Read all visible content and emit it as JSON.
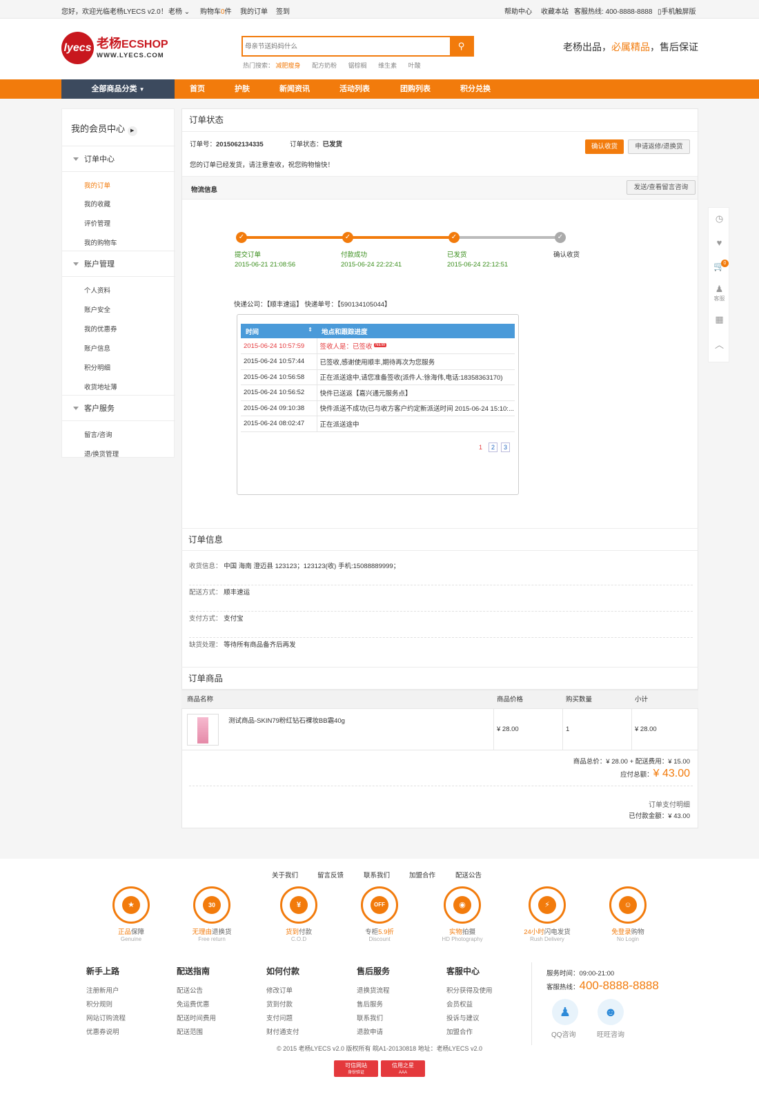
{
  "topbar": {
    "welcome": "您好，欢迎光临老杨LYECS v2.0！",
    "user": "老杨",
    "cart_pre": "购物车",
    "cart_count": "0",
    "cart_suf": "件",
    "orders": "我的订单",
    "signin": "签到",
    "help": "帮助中心",
    "fav": "收藏本站",
    "hotline": "客服热线: 400-8888-8888",
    "mobile": "手机触屏版"
  },
  "header": {
    "logo_badge": "lyecs",
    "logo_cn": "老杨",
    "logo_en": "ECSHOP",
    "logo_url": "WWW.LYECS.COM",
    "search_placeholder": "母亲节送妈妈什么",
    "hot_label": "热门搜索：",
    "hot": [
      "减肥瘦身",
      "配方奶粉",
      "锯棕榈",
      "维生素",
      "叶酸"
    ],
    "slogan_a": "老杨出品，",
    "slogan_b": "必属精品",
    "slogan_c": "，售后保证"
  },
  "nav": {
    "allcat": "全部商品分类",
    "items": [
      "首页",
      "护肤",
      "新闻资讯",
      "活动列表",
      "团购列表",
      "积分兑换"
    ]
  },
  "sidebar": {
    "title": "我的会员中心",
    "sections": [
      {
        "label": "订单中心",
        "items": [
          "我的订单",
          "我的收藏",
          "评价管理",
          "我的购物车"
        ]
      },
      {
        "label": "账户管理",
        "items": [
          "个人资料",
          "账户安全",
          "我的优惠券",
          "账户信息",
          "积分明细",
          "收货地址薄"
        ]
      },
      {
        "label": "客户服务",
        "items": [
          "留言/咨询",
          "退/换货管理"
        ]
      }
    ]
  },
  "order": {
    "status_title": "订单状态",
    "no_label": "订单号：",
    "no": "2015062134335",
    "state_label": "订单状态：",
    "state": "已发货",
    "notice": "您的订单已经发货，请注意查收，祝您购物愉快！",
    "confirm_btn": "确认收货",
    "repair_btn": "申请返修/退换货",
    "logistics": "物流信息",
    "msg_btn": "发送/查看留言咨询"
  },
  "steps": [
    {
      "label": "提交订单",
      "time": "2015-06-21 21:08:56",
      "done": true
    },
    {
      "label": "付款成功",
      "time": "2015-06-24 22:22:41",
      "done": true
    },
    {
      "label": "已发货",
      "time": "2015-06-24 22:12:51",
      "done": true
    },
    {
      "label": "确认收货",
      "time": "",
      "done": false
    }
  ],
  "express": {
    "line": "快递公司：【顺丰速运】 快递单号：【590134105044】",
    "col_time": "时间",
    "col_progress": "地点和跟踪进度",
    "new_tag": "NEW",
    "rows": [
      [
        "2015-06-24 10:57:59",
        "签收人是：已签收"
      ],
      [
        "2015-06-24 10:57:44",
        "已签收,感谢使用顺丰,期待再次为您服务"
      ],
      [
        "2015-06-24 10:56:58",
        "正在派送途中,请您准备签收(派件人:徐海伟,电话:18358363170)"
      ],
      [
        "2015-06-24 10:56:52",
        "快件已送返【嘉兴通元服务点】"
      ],
      [
        "2015-06-24 09:10:38",
        "快件派送不成功(已与收方客户约定新派送时间 2015-06-24 15:10:..."
      ],
      [
        "2015-06-24 08:02:47",
        "正在派送途中"
      ]
    ],
    "pages": [
      "1",
      "2",
      "3"
    ]
  },
  "info": {
    "title": "订单信息",
    "rows": [
      [
        "收货信息：",
        "中国 海南 澄迈县 123123；123123(收) 手机:15088889999；"
      ],
      [
        "配送方式：",
        "顺丰速运"
      ],
      [
        "支付方式：",
        "支付宝"
      ],
      [
        "缺货处理：",
        "等待所有商品备齐后再发"
      ]
    ]
  },
  "goods": {
    "title": "订单商品",
    "cols": [
      "商品名称",
      "商品价格",
      "购买数量",
      "小计"
    ],
    "name": "测试商品-SKIN79粉红钻石裸妆BB霜40g",
    "price": "¥ 28.00",
    "qty": "1",
    "subtotal": "¥ 28.00",
    "sum_line": "商品总价：¥ 28.00 + 配送费用：¥ 15.00",
    "payable_label": "应付总额：",
    "payable": "¥ 43.00",
    "pay_detail": "订单支付明细",
    "paid": "已付款金额：¥ 43.00"
  },
  "rightbar": {
    "service": "客服",
    "cart_count": "0"
  },
  "footer": {
    "links": [
      "关于我们",
      "留言反馈",
      "联系我们",
      "加盟合作",
      "配送公告"
    ],
    "icons": [
      {
        "g": "★",
        "a": "正品",
        "b": "保障",
        "en": "Genuine"
      },
      {
        "g": "30",
        "a": "无理由",
        "b": "退换货",
        "en": "Free return"
      },
      {
        "g": "¥",
        "a": "货到",
        "b": "付款",
        "en": "C.O.D"
      },
      {
        "g": "OFF",
        "a": "专柜",
        "b": "5.9折",
        "en": "Discount",
        "rev": true
      },
      {
        "g": "◉",
        "a": "实物",
        "b": "拍摄",
        "en": "HD Photography"
      },
      {
        "g": "⚡",
        "a": "24小时",
        "b": "闪电发货",
        "en": "Rush Delivery"
      },
      {
        "g": "☺",
        "a": "免登录",
        "b": "购物",
        "en": "No Login"
      }
    ],
    "cols": [
      {
        "h": "新手上路",
        "items": [
          "注册新用户",
          "积分规则",
          "网站订购流程",
          "优惠券说明"
        ]
      },
      {
        "h": "配送指南",
        "items": [
          "配送公告",
          "免运费优惠",
          "配送时间费用",
          "配送范围"
        ]
      },
      {
        "h": "如何付款",
        "items": [
          "修改订单",
          "货到付款",
          "支付问题",
          "财付通支付"
        ]
      },
      {
        "h": "售后服务",
        "items": [
          "退换货流程",
          "售后服务",
          "联系我们",
          "退款申请"
        ]
      },
      {
        "h": "客服中心",
        "items": [
          "积分获得及使用",
          "会员权益",
          "投诉与建议",
          "加盟合作"
        ]
      }
    ],
    "service_time": "服务时间：09:00-21:00",
    "hotline_label": "客服热线：",
    "hotline": "400-8888-8888",
    "qq": "QQ咨询",
    "ww": "旺旺咨询",
    "copyright": "© 2015 老杨LYECS v2.0 版权所有  皖A1-20130818 地址：老杨LYECS v2.0",
    "badge1": "可信网站",
    "badge1b": "身份验证",
    "badge2": "信用之星",
    "badge2b": "AAA"
  }
}
